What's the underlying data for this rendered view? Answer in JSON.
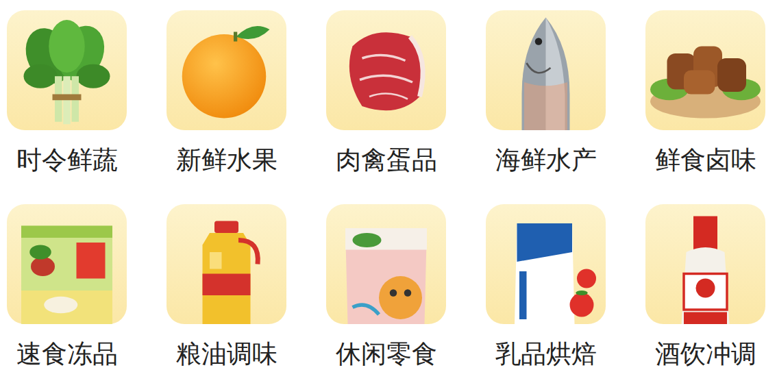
{
  "categories": [
    {
      "label": "时令鲜蔬"
    },
    {
      "label": "新鲜水果"
    },
    {
      "label": "肉禽蛋品"
    },
    {
      "label": "海鲜水产"
    },
    {
      "label": "鲜食卤味"
    },
    {
      "label": "速食冻品"
    },
    {
      "label": "粮油调味"
    },
    {
      "label": "休闲零食"
    },
    {
      "label": "乳品烘焙"
    },
    {
      "label": "酒饮冲调"
    }
  ]
}
